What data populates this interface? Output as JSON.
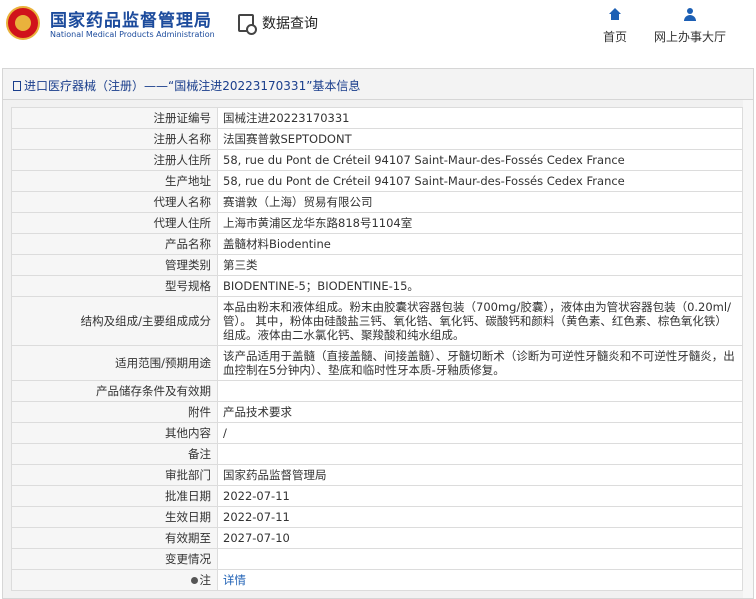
{
  "header": {
    "brand_cn": "国家药品监督管理局",
    "brand_en": "National Medical Products Administration",
    "query_label": "数据查询",
    "nav": [
      {
        "label": "首页",
        "icon": "home-icon"
      },
      {
        "label": "网上办事大厅",
        "icon": "user-icon"
      }
    ]
  },
  "panel": {
    "title": "进口医疗器械（注册）——“国械注进20223170331”基本信息"
  },
  "rows": [
    {
      "label": "注册证编号",
      "value": "国械注进20223170331"
    },
    {
      "label": "注册人名称",
      "value": "法国赛普敦SEPTODONT"
    },
    {
      "label": "注册人住所",
      "value": "58, rue du Pont de Créteil 94107 Saint-Maur-des-Fossés Cedex France"
    },
    {
      "label": "生产地址",
      "value": "58, rue du Pont de Créteil 94107 Saint-Maur-des-Fossés Cedex France"
    },
    {
      "label": "代理人名称",
      "value": "赛谱敦（上海）贸易有限公司"
    },
    {
      "label": "代理人住所",
      "value": "上海市黄浦区龙华东路818号1104室"
    },
    {
      "label": "产品名称",
      "value": "盖髓材料Biodentine"
    },
    {
      "label": "管理类别",
      "value": "第三类"
    },
    {
      "label": "型号规格",
      "value": "BIODENTINE-5；BIODENTINE-15。"
    },
    {
      "label": "结构及组成/主要组成成分",
      "value": "本品由粉末和液体组成。粉末由胶囊状容器包装（700mg/胶囊），液体由为管状容器包装（0.20ml/管）。 其中，粉体由硅酸盐三钙、氧化锆、氧化钙、碳酸钙和颜料（黄色素、红色素、棕色氧化铁）组成。液体由二水氯化钙、聚羧酸和纯水组成。"
    },
    {
      "label": "适用范围/预期用途",
      "value": "该产品适用于盖髓（直接盖髓、间接盖髓）、牙髓切断术（诊断为可逆性牙髓炎和不可逆性牙髓炎，出血控制在5分钟内）、垫底和临时性牙本质-牙釉质修复。"
    },
    {
      "label": "产品储存条件及有效期",
      "value": ""
    },
    {
      "label": "附件",
      "value": "产品技术要求"
    },
    {
      "label": "其他内容",
      "value": "/"
    },
    {
      "label": "备注",
      "value": ""
    },
    {
      "label": "审批部门",
      "value": "国家药品监督管理局"
    },
    {
      "label": "批准日期",
      "value": "2022-07-11"
    },
    {
      "label": "生效日期",
      "value": "2022-07-11"
    },
    {
      "label": "有效期至",
      "value": "2027-07-10"
    },
    {
      "label": "变更情况",
      "value": ""
    }
  ],
  "note": {
    "label": "注",
    "link": "详情"
  }
}
